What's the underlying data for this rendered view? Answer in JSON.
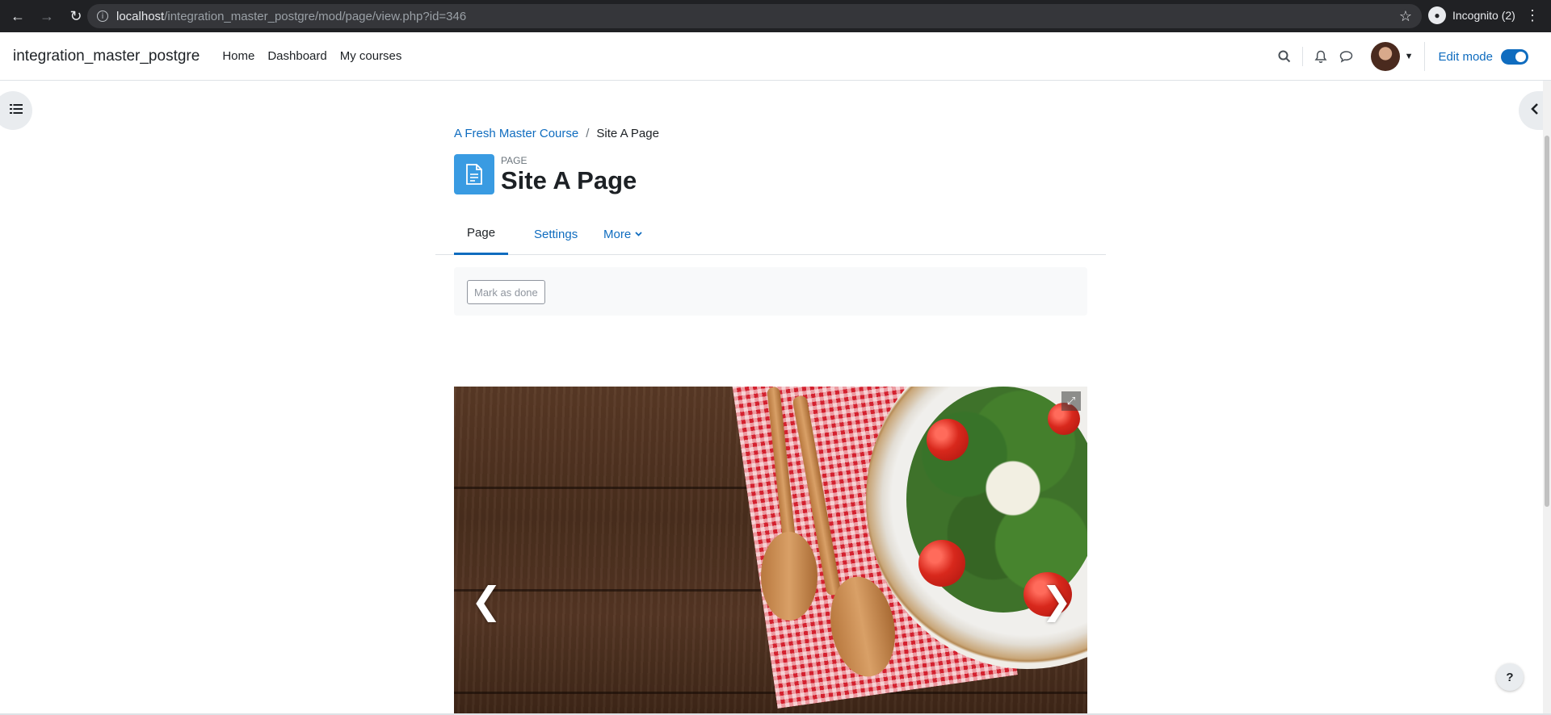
{
  "browser": {
    "url_host": "localhost",
    "url_path": "/integration_master_postgre/mod/page/view.php?id=346",
    "incognito_label": "Incognito (2)"
  },
  "navbar": {
    "brand": "integration_master_postgre",
    "links": [
      "Home",
      "Dashboard",
      "My courses"
    ],
    "edit_mode_label": "Edit mode",
    "edit_mode_on": true
  },
  "breadcrumb": {
    "course": "A Fresh Master Course",
    "separator": "/",
    "current": "Site A Page"
  },
  "header": {
    "kind": "PAGE",
    "title": "Site A Page"
  },
  "secondary_nav": {
    "tabs": [
      "Page",
      "Settings",
      "More"
    ]
  },
  "activity": {
    "mark_done_label": "Mark as done"
  },
  "help": {
    "label": "?"
  },
  "colors": {
    "accent": "#0f6cbf",
    "page_icon": "#399be2"
  }
}
